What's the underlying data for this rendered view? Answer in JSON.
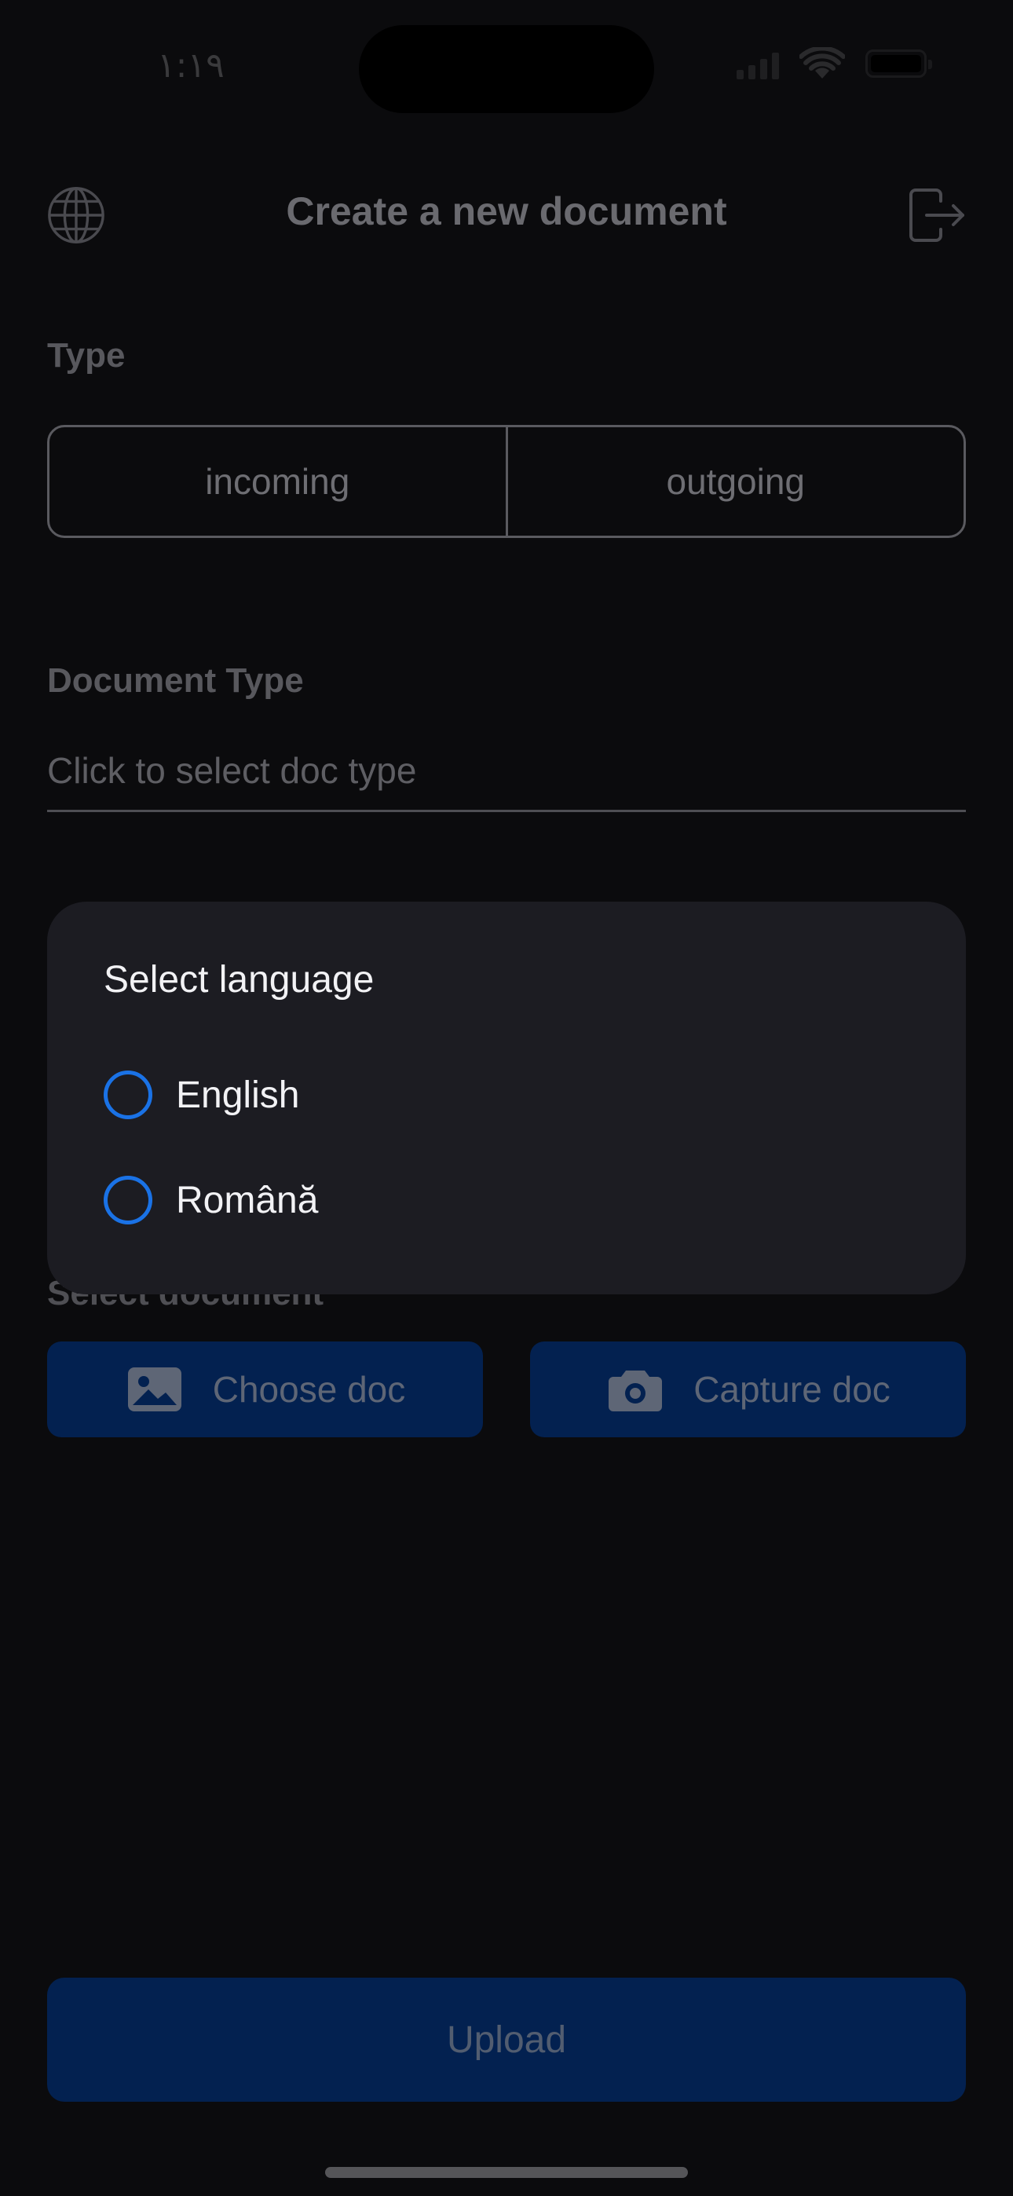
{
  "status_bar": {
    "time": "١:١٩"
  },
  "header": {
    "title": "Create a new document",
    "left_icon": "globe-icon",
    "right_icon": "logout-icon"
  },
  "type_section": {
    "label": "Type",
    "options": [
      "incoming",
      "outgoing"
    ]
  },
  "document_type": {
    "label": "Document Type",
    "placeholder": "Click to select doc type"
  },
  "select_document": {
    "label": "Select document",
    "choose_label": "Choose doc",
    "choose_icon": "image-icon",
    "capture_label": "Capture doc",
    "capture_icon": "camera-icon"
  },
  "upload_label": "Upload",
  "dialog": {
    "title": "Select language",
    "options": [
      {
        "label": "English",
        "selected": false
      },
      {
        "label": "Română",
        "selected": false
      }
    ]
  },
  "colors": {
    "background": "#0b0b0d",
    "dialog": "#1c1c22",
    "accent": "#1a72e6",
    "button_dim": "#032150"
  }
}
